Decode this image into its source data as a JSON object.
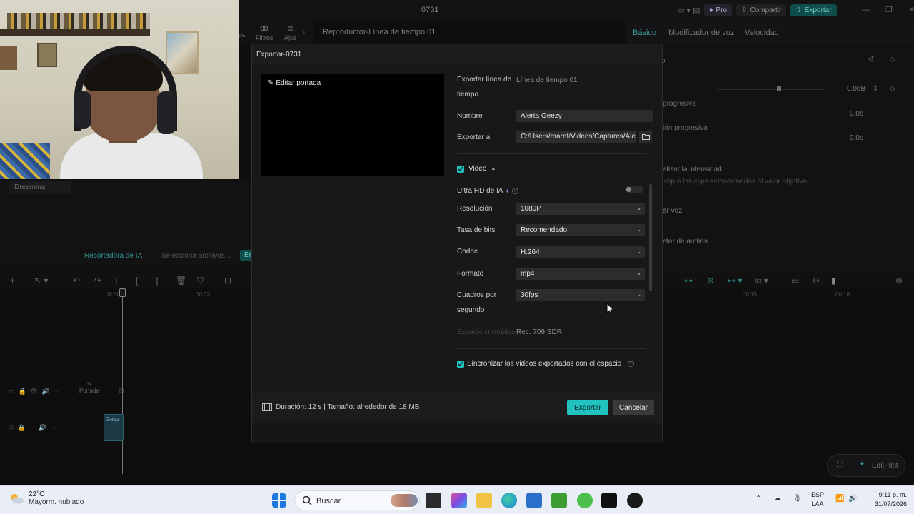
{
  "app": {
    "title": "0731",
    "pro_label": "Pro",
    "share_label": "Compartir",
    "export_label": "Exportar",
    "tools": [
      {
        "label": "los"
      },
      {
        "label": "Filtros"
      },
      {
        "label": "Ajus"
      }
    ]
  },
  "player": {
    "title": "Reproductor-Línea de tiempo 01"
  },
  "right_tabs": [
    {
      "label": "Básico",
      "active": true
    },
    {
      "label": "Modificador de voz",
      "active": false
    },
    {
      "label": "Velocidad",
      "active": false
    }
  ],
  "right_panel": {
    "volume_value": "0.0dB",
    "fade_in_label": "progresiva",
    "fade_in_value": "0.0s",
    "fade_out_label": "ión progresiva",
    "fade_out_value": "0.0s",
    "normalize_label": "alizar la intensidad",
    "normalize_desc": "clip o los clips seleccionados al valor objetivo.",
    "voice_label": "ar voz",
    "audio_label": "ctor de audios"
  },
  "left_panel": {
    "dreamina": "Dreamina",
    "ai_cutter": "Recortadora de IA",
    "ai_select": "Selecciona archivos...",
    "ai_button": "Em"
  },
  "timeline": {
    "ruler_labels": [
      "00:00",
      "00:03",
      "00:15",
      "00:18"
    ],
    "portada_label": "Portada",
    "clip_label": "Geez"
  },
  "editpilot": {
    "label": "EditPilot"
  },
  "modal": {
    "title": "Exportar-0731",
    "cover_edit_label": "Editar portada",
    "export_timeline_label_1": "Exportar línea de",
    "export_timeline_label_2": "tiempo",
    "export_timeline_value": "Línea de tiempo 01",
    "name_label": "Nombre",
    "name_value": "Alerta Geezy",
    "export_to_label": "Exportar a",
    "export_to_value": "C:/Users/maref/Videos/Captures/Ale...",
    "video_section_label": "Video",
    "video_checked": true,
    "ultra_hd_label": "Ultra HD de IA",
    "ultra_hd_enabled": false,
    "resolution_label": "Resolución",
    "resolution_value": "1080P",
    "bitrate_label": "Tasa de bits",
    "bitrate_value": "Recomendado",
    "codec_label": "Codec",
    "codec_value": "H.264",
    "format_label": "Formato",
    "format_value": "mp4",
    "fps_label_1": "Cuadros por",
    "fps_label_2": "segundo",
    "fps_value": "30fps",
    "color_space_label": "Espacio cromático",
    "color_space_value": "Rec. 709 SDR",
    "sync_label": "Sincronizar los videos exportados con el espacio",
    "sync_checked": true,
    "footer_info": "Duración: 12 s | Tamaño: alrededor de 18 MB",
    "export_button": "Exportar",
    "cancel_button": "Cancelar"
  },
  "taskbar": {
    "weather_temp": "22°C",
    "weather_desc": "Mayorm. nublado",
    "search_label": "Buscar",
    "lang_line1": "ESP",
    "lang_line2": "LAA",
    "time": "9:11 p. m.",
    "date": "31/07/2026"
  },
  "colors": {
    "accent": "#22c2c1",
    "modal_bg": "#1c1c1e",
    "field_bg": "#2c2c2e"
  }
}
